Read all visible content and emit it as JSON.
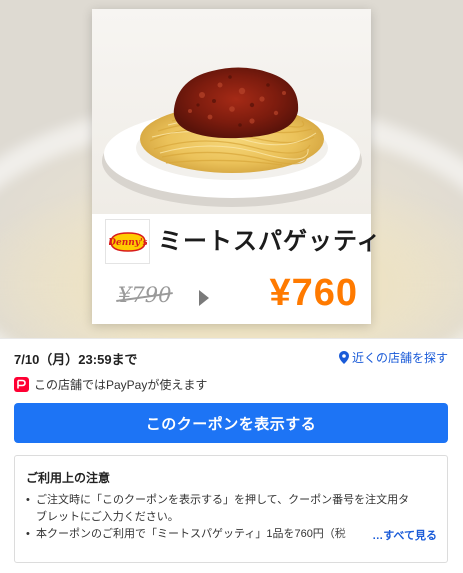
{
  "coupon": {
    "brand_logo_text": "Denny's",
    "product_name": "ミートスパゲッティ",
    "old_price": "¥790",
    "new_price": "¥760"
  },
  "info": {
    "expiry": "7/10（月）23:59まで",
    "nearby_link": "近くの店舗を探す",
    "paypay_note": "この店舗ではPayPayが使えます"
  },
  "actions": {
    "show_coupon_button": "このクーポンを表示する"
  },
  "notes": {
    "title": "ご利用上の注意",
    "item1_line1": "ご注文時に「このクーポンを表示する」を押して、クーポン番号を注文用タ",
    "item1_line2": "ブレットにご入力ください。",
    "item2": "本クーポンのご利用で「ミートスパゲッティ」1品を760円（税",
    "see_all": "…すべて見る"
  },
  "colors": {
    "accent_blue": "#1d74f5",
    "link_blue": "#1a5bd8",
    "price_orange": "#ff7a00",
    "paypay_red": "#ff0033"
  },
  "icons": {
    "location": "location-pin-icon",
    "paypay": "paypay-icon",
    "arrow": "triangle-right-icon"
  }
}
